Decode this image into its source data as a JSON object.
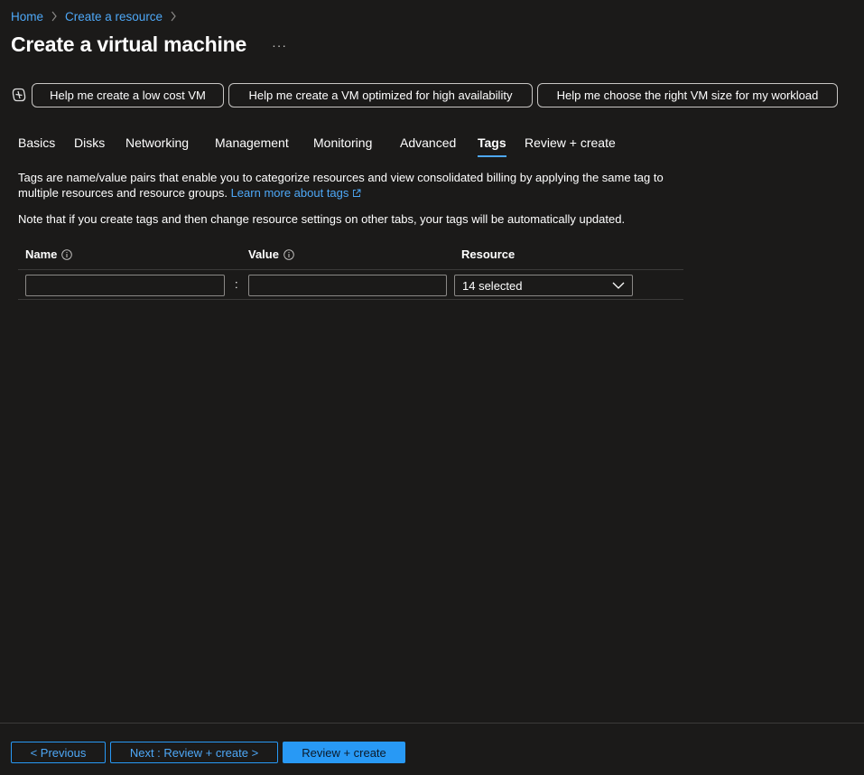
{
  "breadcrumb": {
    "items": [
      "Home",
      "Create a resource"
    ]
  },
  "page": {
    "title": "Create a virtual machine",
    "more_label": "···"
  },
  "assist": {
    "prompts": [
      "Help me create a low cost VM",
      "Help me create a VM optimized for high availability",
      "Help me choose the right VM size for my workload"
    ]
  },
  "tabs": {
    "items": [
      "Basics",
      "Disks",
      "Networking",
      "Management",
      "Monitoring",
      "Advanced",
      "Tags",
      "Review + create"
    ],
    "active": "Tags"
  },
  "content": {
    "description": "Tags are name/value pairs that enable you to categorize resources and view consolidated billing by applying the same tag to multiple resources and resource groups.",
    "learn_more": "Learn more about tags",
    "note": "Note that if you create tags and then change resource settings on other tabs, your tags will be automatically updated."
  },
  "tags_table": {
    "headers": {
      "name": "Name",
      "value": "Value",
      "resource": "Resource"
    },
    "row": {
      "name_value": "",
      "value_value": "",
      "separator": ":",
      "resource_selected": "14 selected"
    }
  },
  "footer": {
    "previous": "< Previous",
    "next": "Next : Review + create >",
    "review_create": "Review + create"
  },
  "colors": {
    "background": "#1b1a19",
    "accent": "#4ea8f7",
    "primary_button": "#2899f5",
    "border": "#8a8886"
  },
  "icons": {
    "breadcrumb_separator": "chevron-right-icon",
    "copilot": "copilot-icon",
    "external_link": "external-link-icon",
    "info": "info-icon",
    "dropdown": "chevron-down-icon"
  }
}
